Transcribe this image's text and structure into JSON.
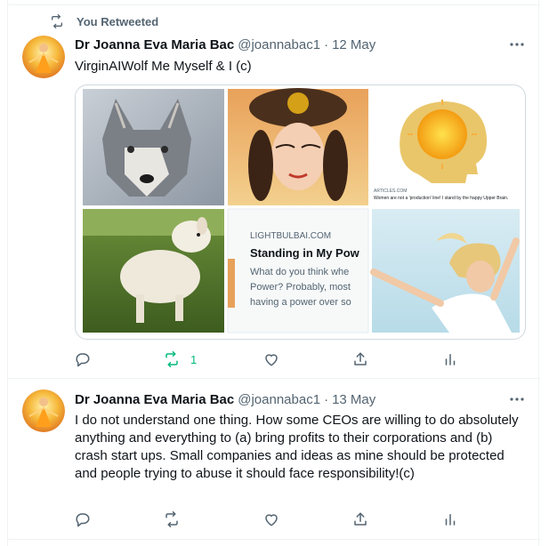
{
  "colors": {
    "text_primary": "#0f1419",
    "text_secondary": "#536471",
    "retweet_active": "#00ba7c",
    "border": "#eff3f4"
  },
  "retweet_banner": {
    "icon": "retweet-icon",
    "label": "You Retweeted"
  },
  "tweets": [
    {
      "author_name": "Dr Joanna Eva Maria Bac",
      "handle": "@joannabac1",
      "separator": "·",
      "date": "12 May",
      "text": "VirginAIWolf Me Myself & I (c)",
      "media": {
        "tiles": [
          {
            "content": "wolf-photo"
          },
          {
            "content": "portrait-headdress"
          },
          {
            "content": "sun-head-graphic",
            "caption": "ARTICLES.COM",
            "caption_line": "Women are not a 'production' line! I stand by the happy Upper Brain."
          },
          {
            "content": "lamb-photo"
          },
          {
            "content": "link-card",
            "site": "LIGHTBULBAI.COM",
            "title": "Standing in My Pow",
            "snippet_line1": "What do you think whe",
            "snippet_line2": "Power? Probably, most",
            "snippet_line3": "having a power over so"
          },
          {
            "content": "woman-sky-photo"
          }
        ]
      },
      "actions": {
        "reply": {
          "icon": "reply-icon",
          "count": ""
        },
        "retweet": {
          "icon": "retweet-icon",
          "count": "1",
          "active": true
        },
        "like": {
          "icon": "heart-icon",
          "count": ""
        },
        "share": {
          "icon": "share-icon",
          "count": ""
        },
        "analytics": {
          "icon": "analytics-icon",
          "count": ""
        }
      }
    },
    {
      "author_name": "Dr Joanna Eva Maria Bac",
      "handle": "@joannabac1",
      "separator": "·",
      "date": "13 May",
      "text": "I do not understand one thing. How some CEOs are willing to do absolutely anything and everything to (a) bring profits to their corporations and (b) crash start ups. Small companies and ideas as mine should be protected and people trying to abuse it should face responsibility!(c)",
      "actions": {
        "reply": {
          "icon": "reply-icon",
          "count": ""
        },
        "retweet": {
          "icon": "retweet-icon",
          "count": "",
          "active": false
        },
        "like": {
          "icon": "heart-icon",
          "count": ""
        },
        "share": {
          "icon": "share-icon",
          "count": ""
        },
        "analytics": {
          "icon": "analytics-icon",
          "count": ""
        }
      }
    }
  ]
}
